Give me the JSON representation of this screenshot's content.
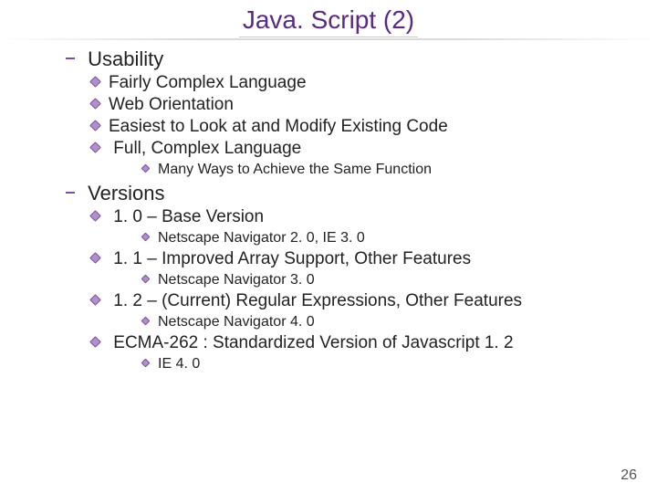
{
  "title": "Java. Script (2)",
  "page_number": "26",
  "sections": [
    {
      "heading": "Usability",
      "items": [
        {
          "text": "Fairly Complex Language",
          "sub": []
        },
        {
          "text": "Web Orientation",
          "sub": []
        },
        {
          "text": "Easiest to Look at and Modify Existing Code",
          "sub": []
        },
        {
          "text": "Full, Complex Language",
          "sub": [
            "Many Ways to Achieve the Same Function"
          ]
        }
      ]
    },
    {
      "heading": "Versions",
      "items": [
        {
          "text": "1. 0 – Base Version",
          "sub": [
            "Netscape Navigator 2. 0,  IE  3. 0"
          ]
        },
        {
          "text": "1. 1 – Improved Array Support, Other Features",
          "sub": [
            "Netscape Navigator 3. 0"
          ]
        },
        {
          "text": "1. 2 – (Current) Regular Expressions, Other Features",
          "sub": [
            "Netscape Navigator 4. 0"
          ]
        },
        {
          "text": "ECMA-262 : Standardized Version of Javascript 1. 2",
          "sub": [
            "IE 4. 0"
          ]
        }
      ]
    }
  ]
}
